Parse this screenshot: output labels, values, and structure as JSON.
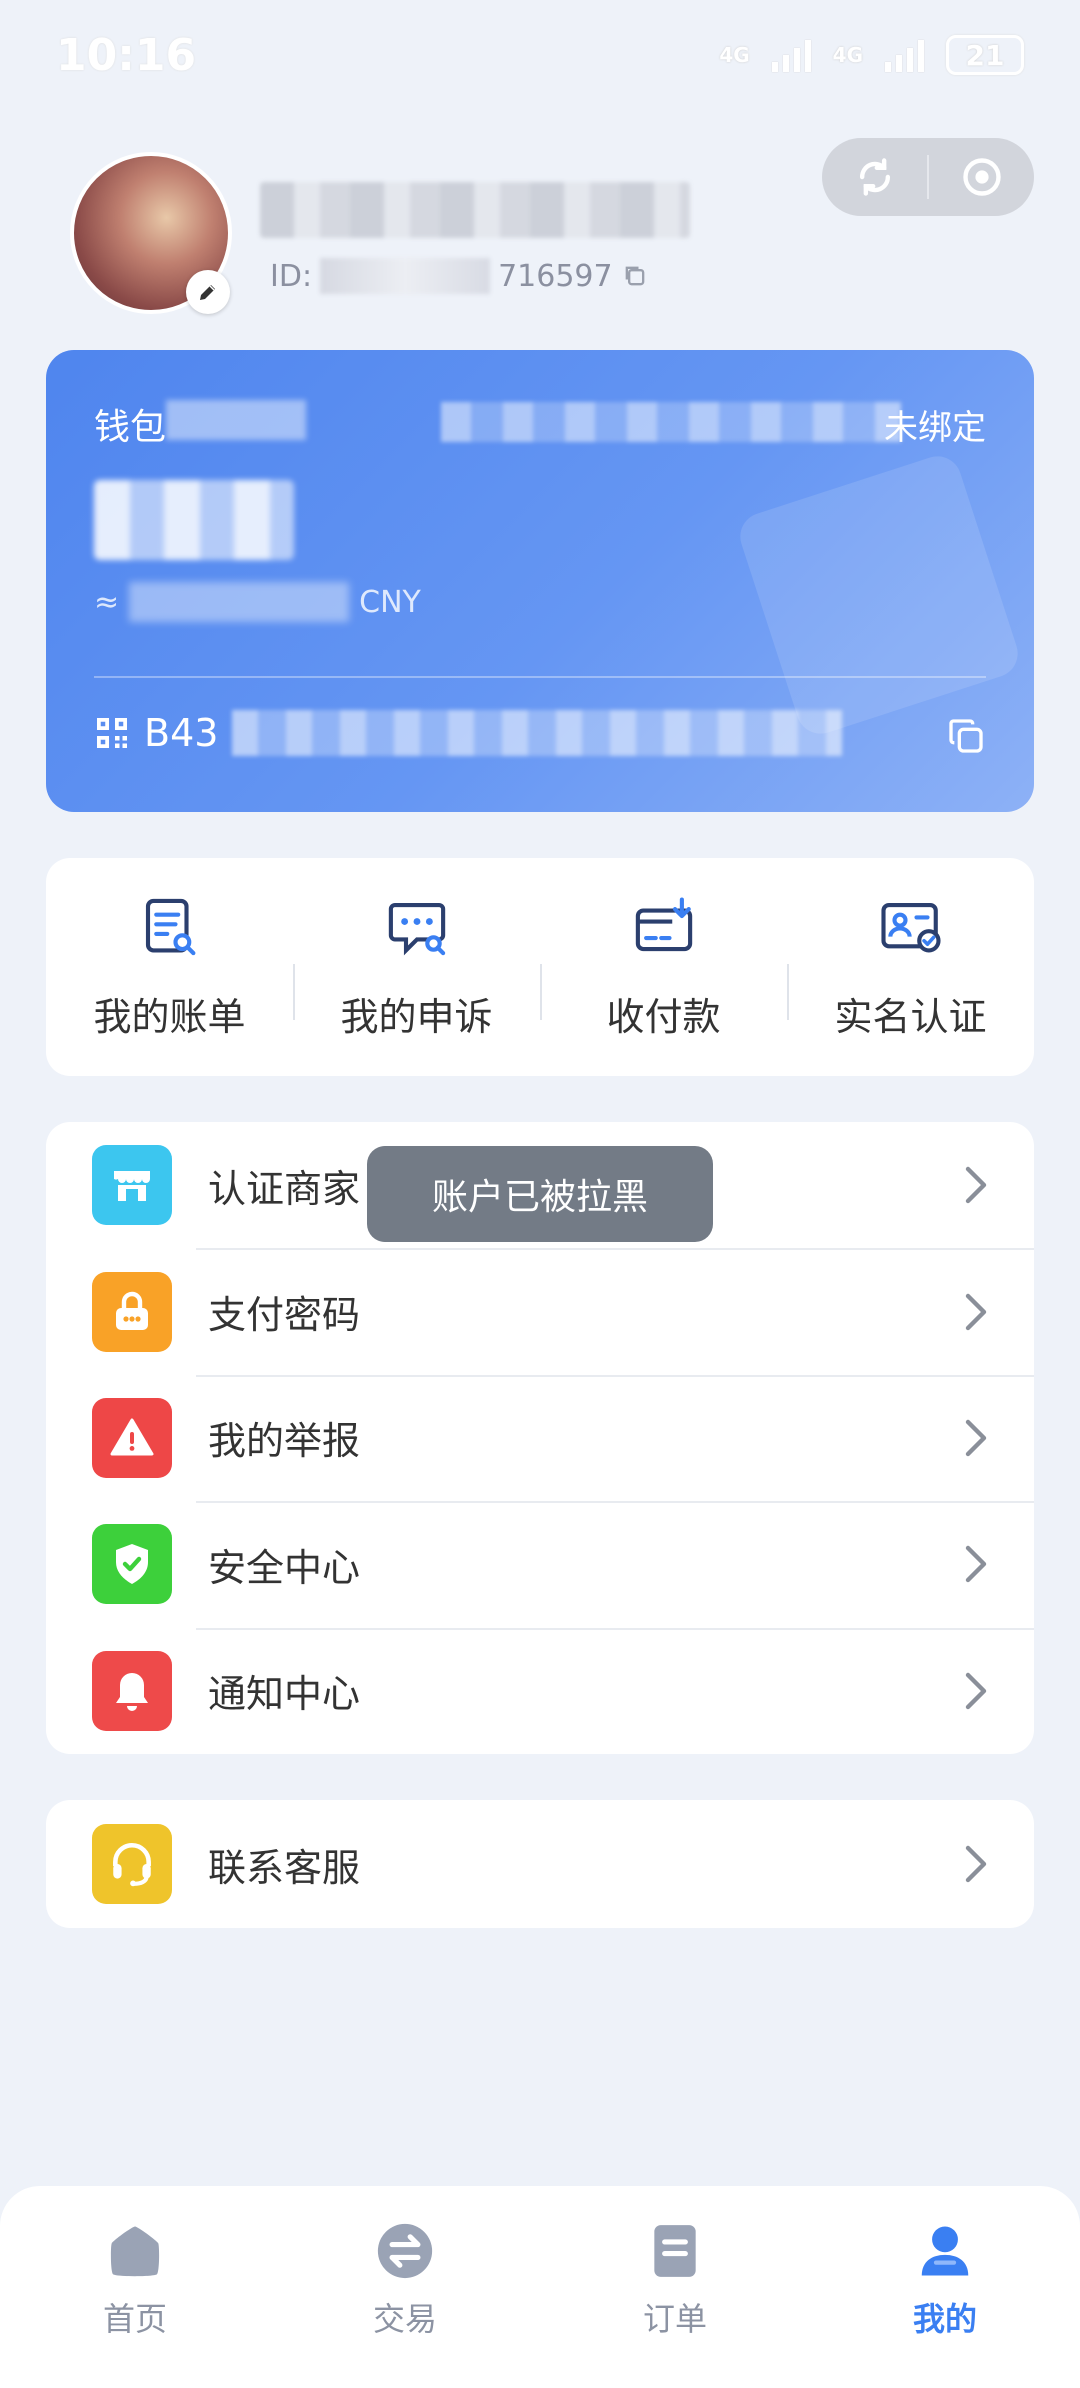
{
  "status_bar": {
    "time": "10:16",
    "network_1": "4G",
    "network_2": "4G",
    "battery": "21"
  },
  "profile": {
    "id_prefix": "ID:",
    "id_suffix": "716597"
  },
  "wallet": {
    "label": "钱包",
    "bind_status": "未绑定",
    "approx_prefix": "≈",
    "approx_suffix": "CNY",
    "address_prefix": "B43"
  },
  "quick_actions": [
    {
      "label": "我的账单",
      "icon": "bill-icon"
    },
    {
      "label": "我的申诉",
      "icon": "appeal-icon"
    },
    {
      "label": "收付款",
      "icon": "payment-icon"
    },
    {
      "label": "实名认证",
      "icon": "id-verify-icon"
    }
  ],
  "menu": [
    {
      "label": "认证商家",
      "icon": "store-icon",
      "color": "#3cc6ef"
    },
    {
      "label": "支付密码",
      "icon": "lock-icon",
      "color": "#f9a227"
    },
    {
      "label": "我的举报",
      "icon": "warning-icon",
      "color": "#ee4747"
    },
    {
      "label": "安全中心",
      "icon": "shield-icon",
      "color": "#3dd03b"
    },
    {
      "label": "通知中心",
      "icon": "bell-icon",
      "color": "#ee4a4a"
    }
  ],
  "service": {
    "label": "联系客服",
    "icon": "headset-icon",
    "color": "#efc42b"
  },
  "toast": {
    "message": "账户已被拉黑"
  },
  "tabbar": [
    {
      "label": "首页",
      "icon": "home-icon",
      "active": false
    },
    {
      "label": "交易",
      "icon": "exchange-icon",
      "active": false
    },
    {
      "label": "订单",
      "icon": "order-icon",
      "active": false
    },
    {
      "label": "我的",
      "icon": "user-icon",
      "active": true
    }
  ],
  "colors": {
    "accent": "#3a7ff2",
    "card_start": "#4f85ee",
    "card_end": "#8db1f6",
    "background": "#eef2f9"
  }
}
